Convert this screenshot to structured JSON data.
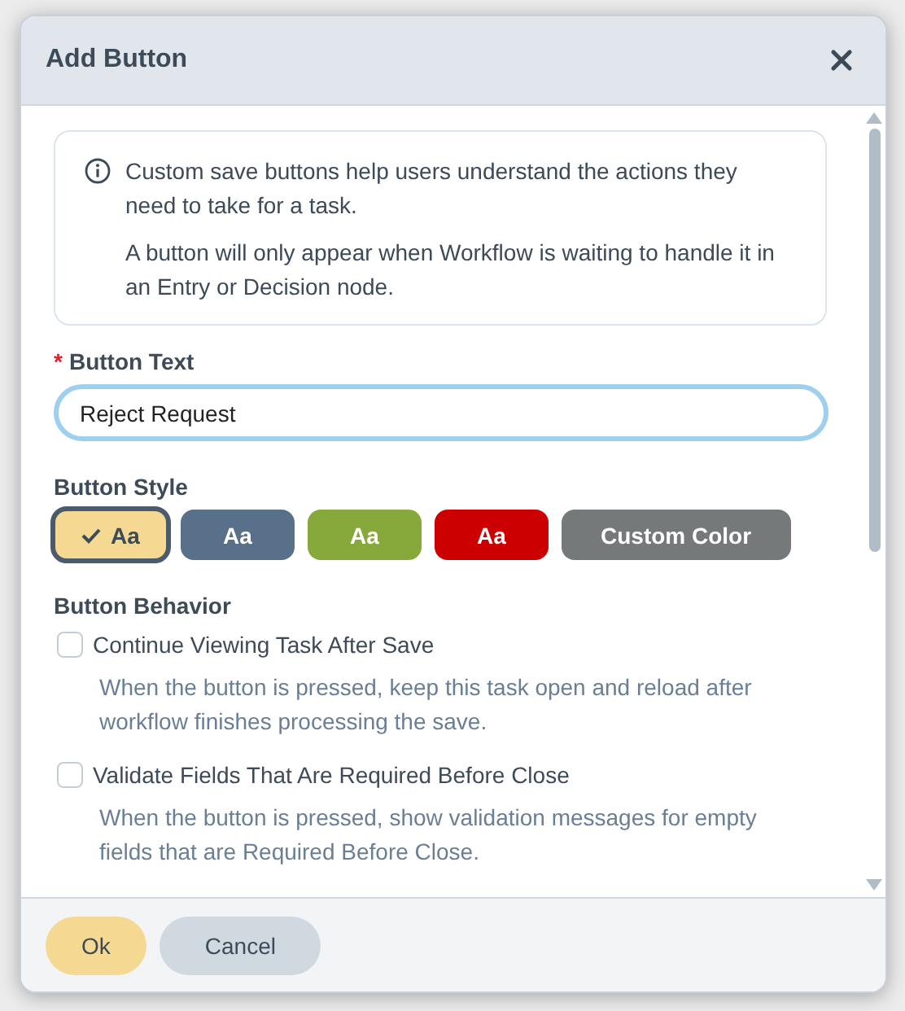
{
  "dialog": {
    "title": "Add Button"
  },
  "info": {
    "paragraphs": [
      "Custom save buttons help users understand the actions they need to take for a task.",
      "A button will only appear when Workflow is waiting to handle it in an Entry or Decision node."
    ]
  },
  "button_text": {
    "label": "Button Text",
    "required_mark": "*",
    "value": "Reject Request",
    "focused": true
  },
  "button_style": {
    "label": "Button Style",
    "options": [
      {
        "label": "Aa",
        "color": "#f5d993",
        "selected": true
      },
      {
        "label": "Aa",
        "color": "#587089",
        "selected": false
      },
      {
        "label": "Aa",
        "color": "#87a83a",
        "selected": false
      },
      {
        "label": "Aa",
        "color": "#cc0000",
        "selected": false
      },
      {
        "label": "Custom Color",
        "color": "#757979",
        "selected": false
      }
    ]
  },
  "button_behavior": {
    "label": "Button Behavior",
    "options": [
      {
        "label": "Continue Viewing Task After Save",
        "description": "When the button is pressed, keep this task open and reload after workflow finishes processing the save.",
        "checked": false
      },
      {
        "label": "Validate Fields That Are Required Before Close",
        "description": "When the button is pressed, show validation messages for empty fields that are Required Before Close.",
        "checked": false
      }
    ]
  },
  "footer": {
    "buttons": [
      {
        "label": "Ok",
        "kind": "primary"
      },
      {
        "label": "Cancel",
        "kind": "secondary"
      }
    ]
  }
}
